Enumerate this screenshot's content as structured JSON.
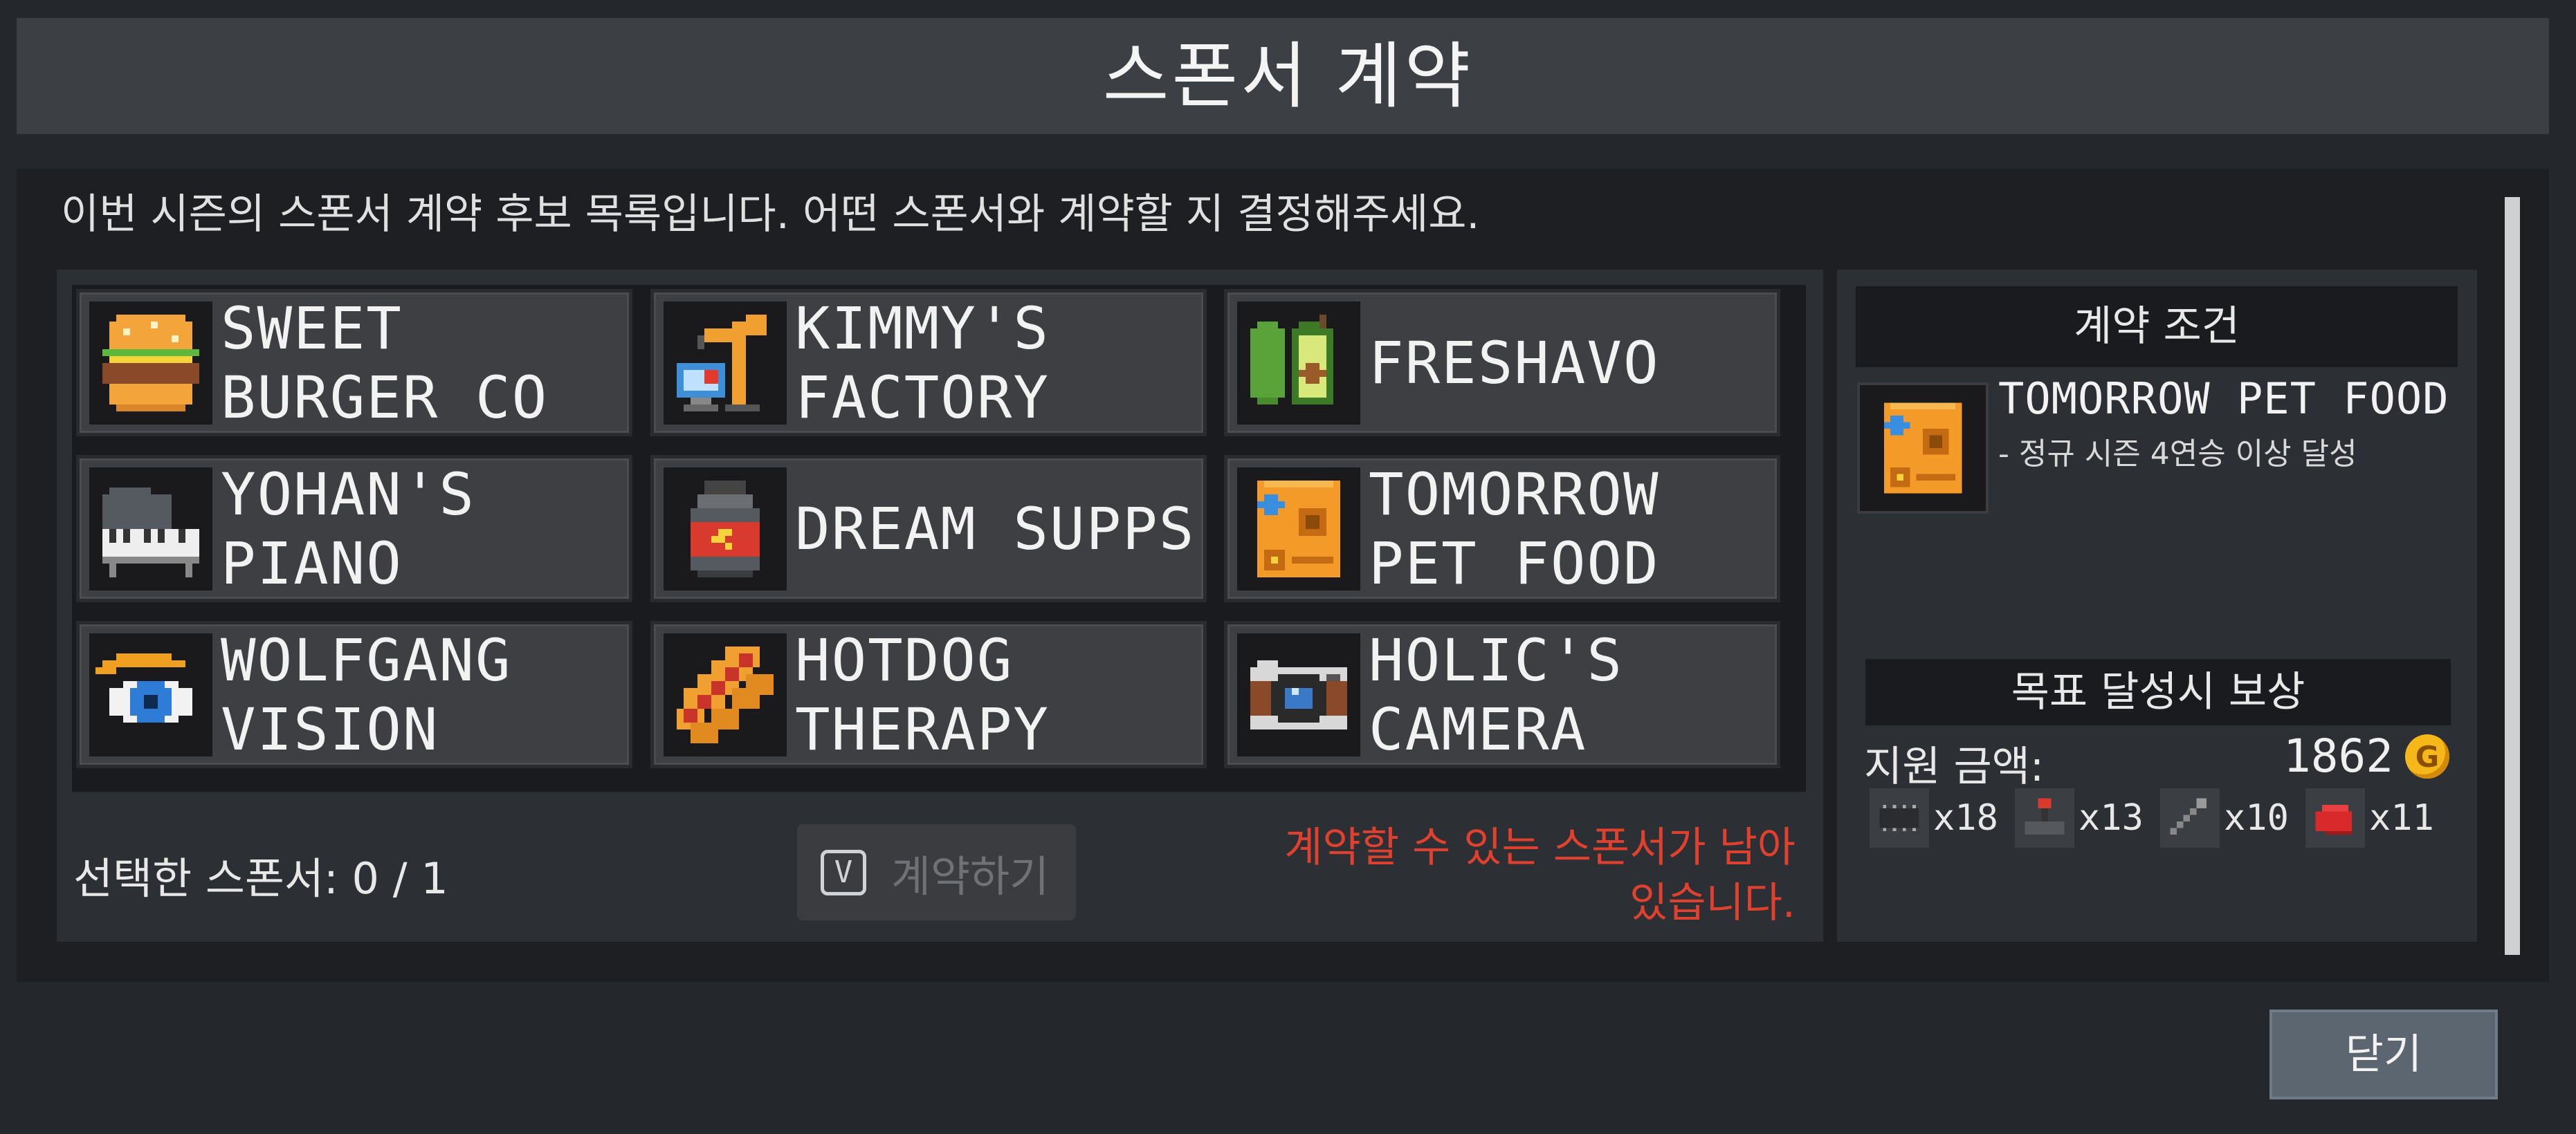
{
  "window": {
    "title": "스폰서 계약"
  },
  "intro": "이번 시즌의 스폰서 계약 후보 목록입니다. 어떤 스폰서와 계약할 지 결정해주세요.",
  "sponsors": [
    {
      "name": "SWEET\nBURGER CO",
      "icon": "burger-icon"
    },
    {
      "name": "KIMMY'S\nFACTORY",
      "icon": "robot-arm-icon"
    },
    {
      "name": "FRESHAVO",
      "icon": "avocado-icon"
    },
    {
      "name": "YOHAN'S\nPIANO",
      "icon": "piano-icon"
    },
    {
      "name": "DREAM SUPPS",
      "icon": "supplement-jar-icon"
    },
    {
      "name": "TOMORROW\nPET FOOD",
      "icon": "pet-food-bag-icon"
    },
    {
      "name": "WOLFGANG\nVISION",
      "icon": "eye-icon"
    },
    {
      "name": "HOTDOG\nTHERAPY",
      "icon": "hotdog-icon"
    },
    {
      "name": "HOLIC'S\nCAMERA",
      "icon": "camera-icon"
    }
  ],
  "footer": {
    "selected_count": "선택한 스폰서: 0 / 1",
    "contract_key": "V",
    "contract_label": "계약하기",
    "warning": "계약할 수 있는 스폰서가 남아\n있습니다."
  },
  "details": {
    "conditions_header": "계약 조건",
    "sponsor_name": "TOMORROW PET FOOD",
    "condition": "- 정규 시즌 4연승 이상 달성",
    "reward_header": "목표 달성시 보상",
    "fund_label": "지원 금액:",
    "fund_value": "1862",
    "coin_symbol": "G",
    "items": [
      {
        "icon": "chip-icon",
        "qty": "x18"
      },
      {
        "icon": "joystick-icon",
        "qty": "x13"
      },
      {
        "icon": "wrench-icon",
        "qty": "x10"
      },
      {
        "icon": "red-cloth-icon",
        "qty": "x11"
      }
    ]
  },
  "close_label": "닫기",
  "colors": {
    "warning": "#e0402e",
    "coin": "#f5b818",
    "panel": "#1d1f22"
  }
}
